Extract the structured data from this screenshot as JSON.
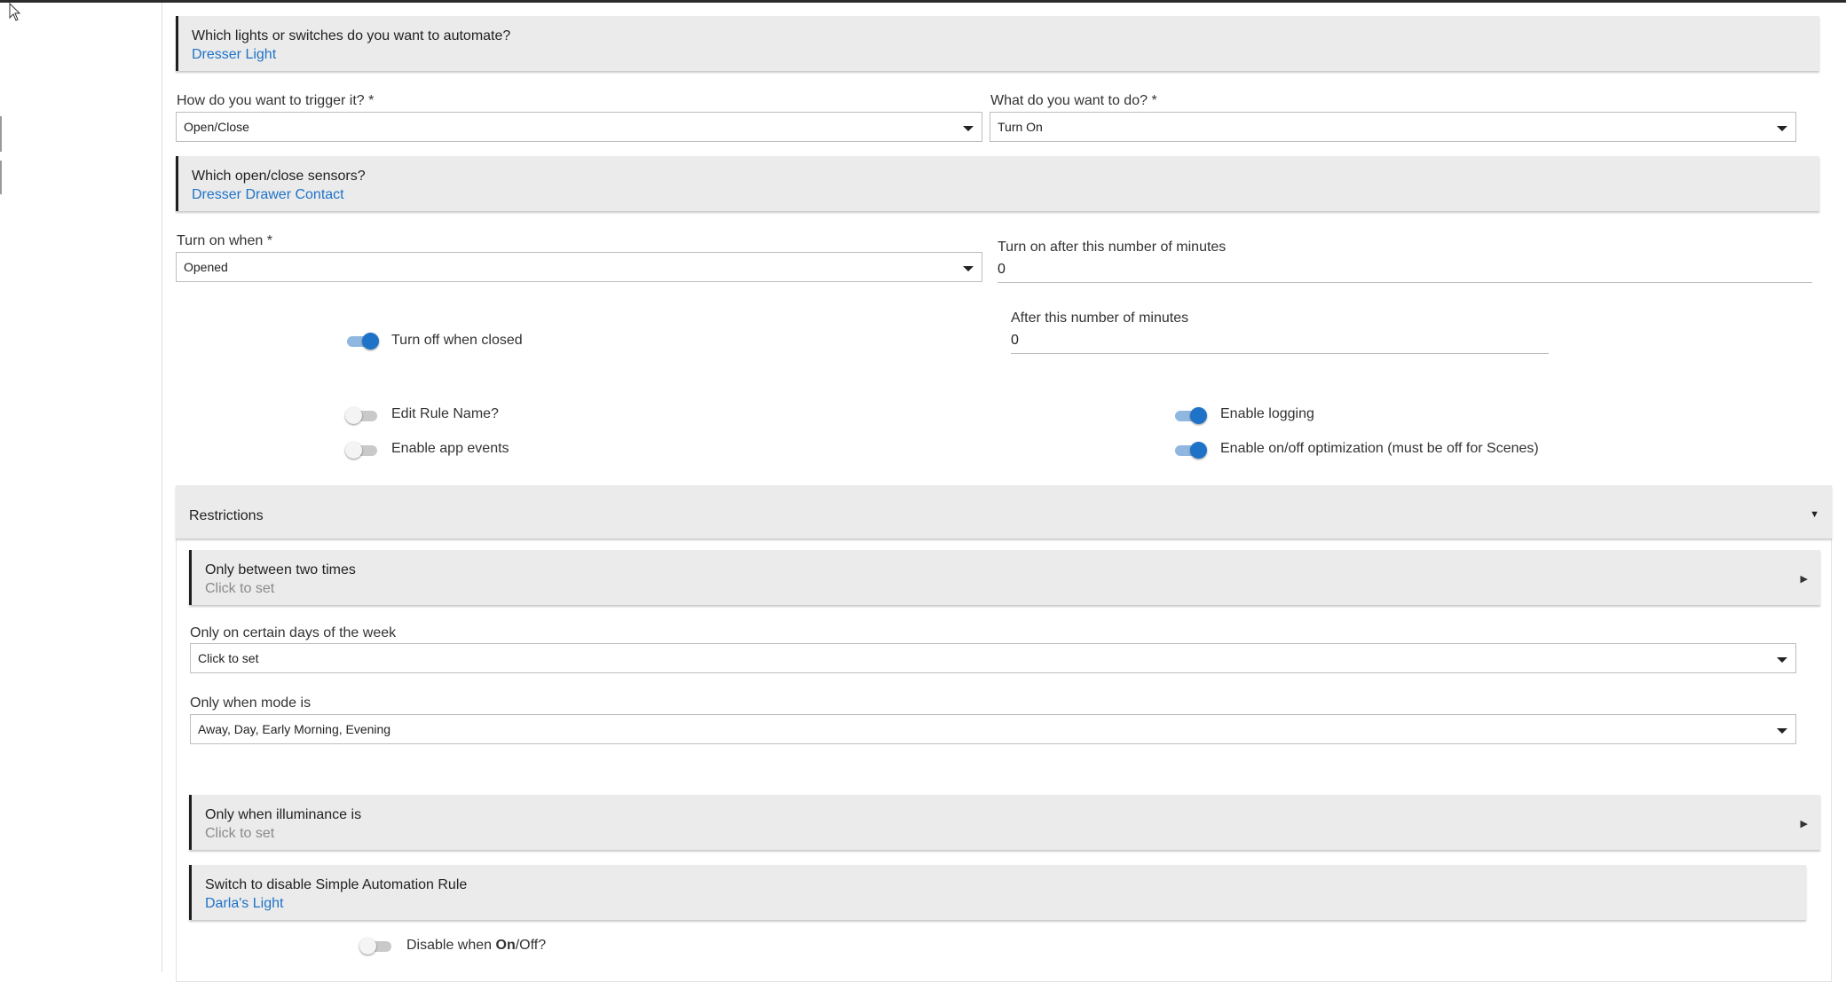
{
  "lights": {
    "question": "Which lights or switches do you want to automate?",
    "value": "Dresser Light"
  },
  "trigger": {
    "label": "How do you want to trigger it? *",
    "value": "Open/Close"
  },
  "action": {
    "label": "What do you want to do? *",
    "value": "Turn On"
  },
  "sensors": {
    "question": "Which open/close sensors?",
    "value": "Dresser Drawer Contact"
  },
  "turn_on_when": {
    "label": "Turn on when *",
    "value": "Opened"
  },
  "turn_on_after": {
    "label": "Turn on after this number of minutes",
    "value": "0"
  },
  "turn_off_closed": {
    "label": "Turn off when closed",
    "on": true
  },
  "after_minutes": {
    "label": "After this number of minutes",
    "value": "0"
  },
  "options": {
    "edit_rule_name": {
      "label": "Edit Rule Name?",
      "on": false
    },
    "enable_app_events": {
      "label": "Enable app events",
      "on": false
    },
    "enable_logging": {
      "label": "Enable logging",
      "on": true
    },
    "enable_optimization": {
      "label": "Enable on/off optimization (must be off for Scenes)",
      "on": true
    }
  },
  "restrictions": {
    "title": "Restrictions",
    "between_times": {
      "title": "Only between two times",
      "value": "Click to set"
    },
    "days": {
      "label": "Only on certain days of the week",
      "value": "Click to set"
    },
    "mode": {
      "label": "Only when mode is",
      "value": "Away, Day, Early Morning, Evening"
    },
    "illuminance": {
      "title": "Only when illuminance is",
      "value": "Click to set"
    },
    "disable_switch": {
      "title": "Switch to disable Simple Automation Rule",
      "value": "Darla's Light"
    },
    "disable_when": {
      "prefix": "Disable when ",
      "bold": "On",
      "suffix": "/Off?",
      "on": false
    }
  },
  "colors": {
    "accent": "#1e73c8",
    "card_bg": "#ebebeb"
  }
}
